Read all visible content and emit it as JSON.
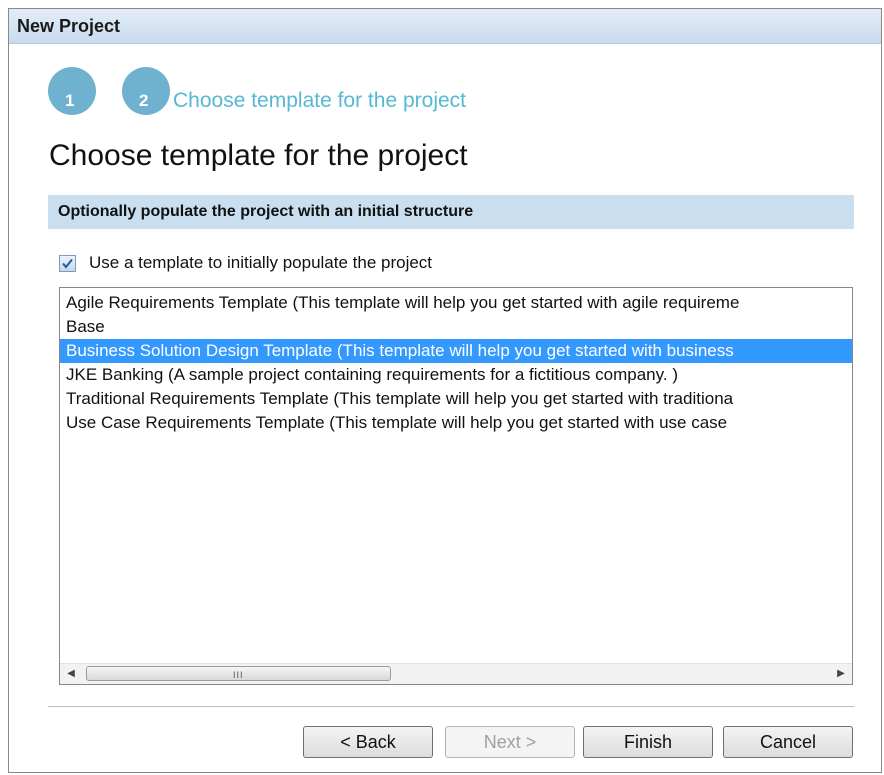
{
  "window": {
    "title": "New Project"
  },
  "steps": [
    {
      "number": "1"
    },
    {
      "number": "2",
      "label": "Choose template for the project"
    }
  ],
  "page": {
    "heading": "Choose template for the project",
    "section_title": "Optionally populate the project with an initial structure"
  },
  "template_option": {
    "checked": true,
    "label": "Use a template to initially populate the project"
  },
  "templates": {
    "selected_index": 2,
    "items": [
      "Agile Requirements Template (This template will help you get started with agile requireme",
      "Base",
      "Business Solution Design Template (This template will help you get started with business",
      "JKE Banking (A sample project containing requirements for a fictitious company. )",
      "Traditional Requirements Template (This template will help you get started with traditiona",
      "Use Case Requirements Template (This template will help you get started with use case"
    ]
  },
  "scrollbar": {
    "grip": "III"
  },
  "buttons": {
    "back": "< Back",
    "next": "Next >",
    "finish": "Finish",
    "cancel": "Cancel"
  },
  "colors": {
    "step_circle": "#6fb2cf",
    "step_label": "#57b8d3",
    "section_bar": "#c9dff0",
    "selection": "#3399ff"
  }
}
